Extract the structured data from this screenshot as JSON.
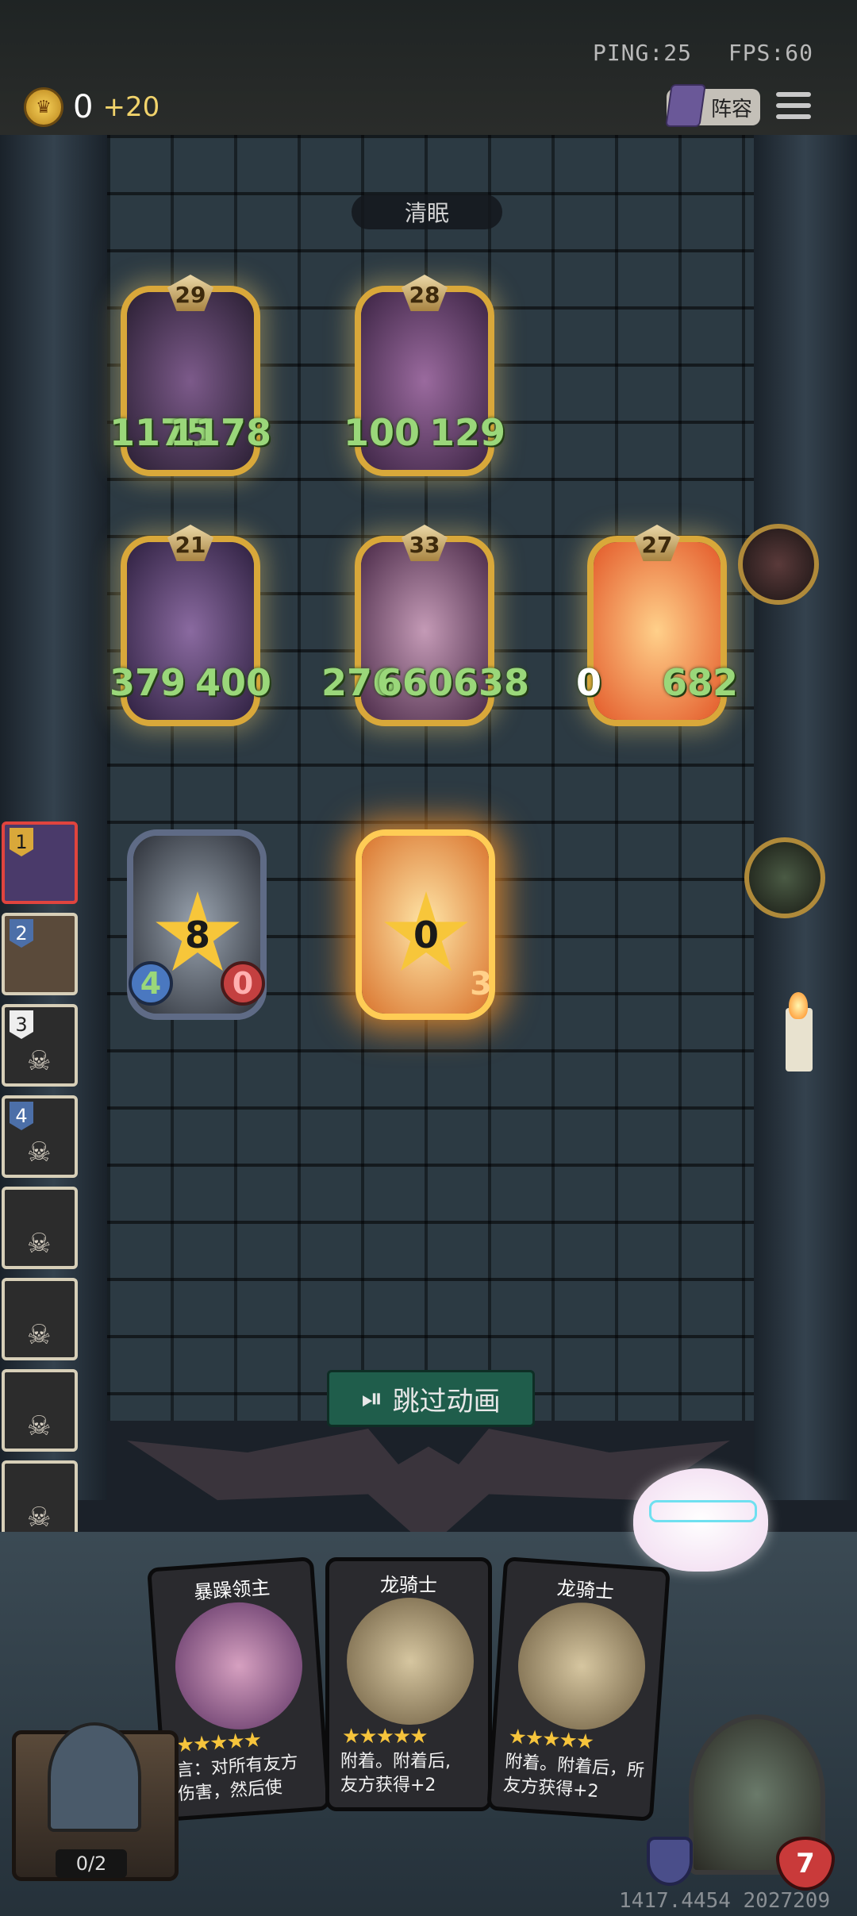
{
  "status": {
    "ping": "PING:25",
    "fps": "FPS:60"
  },
  "gold": {
    "value": "0",
    "increment": "+20"
  },
  "buttons": {
    "lineup": "阵容",
    "skip": "跳过动画"
  },
  "round_label": "清眠",
  "enemy_board": [
    {
      "level": "29",
      "attack": "1175",
      "health": "1178"
    },
    {
      "level": "28",
      "attack": "100",
      "health": "129"
    },
    {
      "level": "21",
      "attack": "379",
      "health": "400"
    },
    {
      "level": "33",
      "attack": "276",
      "health": "660638"
    },
    {
      "level": "27",
      "attack": "0",
      "health": "682"
    }
  ],
  "player_board": [
    {
      "burst": "8",
      "attack": "4",
      "health": "0"
    },
    {
      "burst": "0",
      "health": "3"
    }
  ],
  "timeline": [
    "1",
    "2",
    "3",
    "4"
  ],
  "hand": [
    {
      "title": "暴躁领主",
      "stars": "★★★★★",
      "desc": "言：对所有友方\n伤害，然后使"
    },
    {
      "title": "龙骑士",
      "stars": "★★★★★",
      "desc": "附着。附着后,\n友方获得+2"
    },
    {
      "title": "龙骑士",
      "stars": "★★★★★",
      "desc": "附着。附着后，所\n友方获得+2"
    }
  ],
  "deck_counter": "0/2",
  "hero_health": "7",
  "footer_coords": "1417.4454 2027209",
  "colors": {
    "gold": "#d9a83a",
    "stat_green": "#9ad77a",
    "skip_bg": "#1f5d4b"
  }
}
